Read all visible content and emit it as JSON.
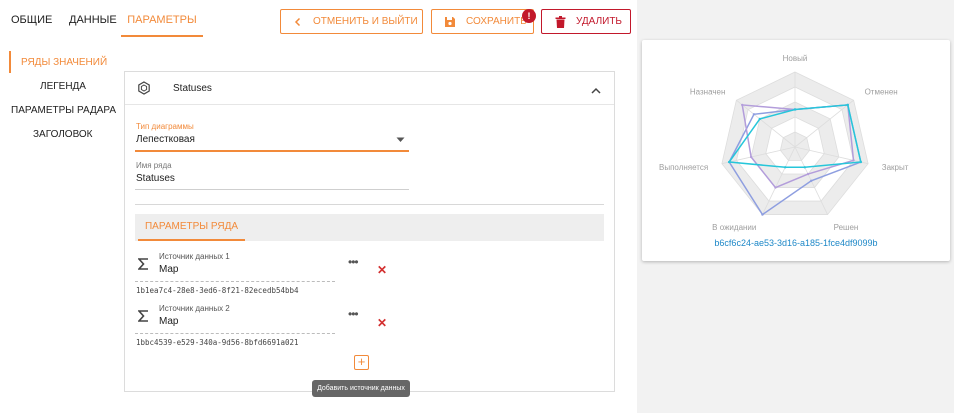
{
  "top_tabs": [
    "ОБЩИЕ",
    "ДАННЫЕ",
    "ПАРАМЕТРЫ"
  ],
  "actions": {
    "cancel": "ОТМЕНИТЬ И ВЫЙТИ",
    "save": "СОХРАНИТЬ",
    "save_badge": "!",
    "delete": "УДАЛИТЬ"
  },
  "side_nav": [
    "РЯДЫ ЗНАЧЕНИЙ",
    "ЛЕГЕНДА",
    "ПАРАМЕТРЫ РАДАРА",
    "ЗАГОЛОВОК"
  ],
  "series": {
    "title": "Statuses",
    "chart_type_label": "Тип диаграммы",
    "chart_type_value": "Лепестковая",
    "name_label": "Имя ряда",
    "name_value": "Statuses",
    "subtab": "ПАРАМЕТРЫ РЯДА",
    "sources": [
      {
        "label": "Источник данных 1",
        "value": "Map",
        "id": "1b1ea7c4-28e8-3ed6-8f21-82ecedb54bb4"
      },
      {
        "label": "Источник данных 2",
        "value": "Map",
        "id": "1bbc4539-e529-340a-9d56-8bfd6691a021"
      }
    ],
    "add_tooltip": "Добавить источник данных"
  },
  "colors": {
    "accent": "#f28a3a",
    "danger": "#c2182b",
    "series1": "#8e9ee0",
    "series2": "#b39ddb",
    "series3": "#26c6da"
  },
  "chart_data": {
    "type": "radar",
    "categories": [
      "Новый",
      "Отменен",
      "Закрыт",
      "Решен",
      "В ожидании",
      "Выполняется",
      "Назначен"
    ],
    "rmax": 10,
    "grid_levels": 5,
    "series": [
      {
        "color": "#8e9ee0",
        "values": [
          5,
          9,
          9,
          5,
          10,
          9,
          7
        ]
      },
      {
        "color": "#b39ddb",
        "values": [
          5,
          9,
          8,
          4,
          6,
          6,
          9
        ]
      },
      {
        "color": "#26c6da",
        "values": [
          5,
          9,
          9,
          3,
          3,
          9,
          6
        ]
      }
    ],
    "id": "b6cf6c24-ae53-3d16-a185-1fce4df9099b"
  }
}
